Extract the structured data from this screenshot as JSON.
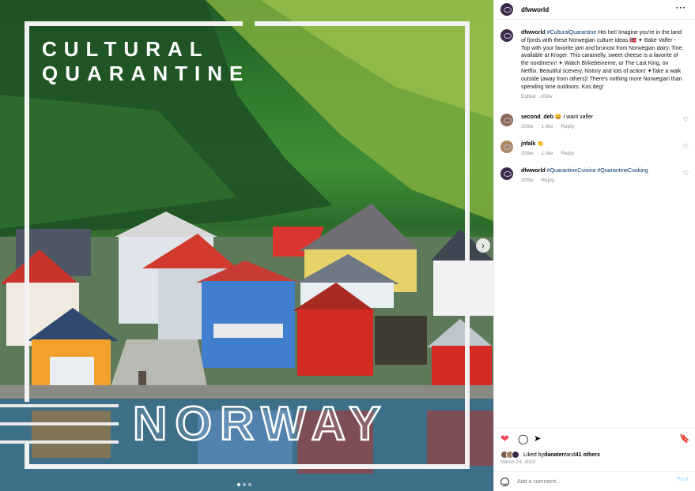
{
  "image": {
    "title_line1": "CULTURAL",
    "title_line2": "QUARANTINE",
    "big_word": "NORWAY",
    "next_glyph": "›"
  },
  "header": {
    "username": "dfwworld",
    "more_glyph": "···"
  },
  "caption": {
    "username": "dfwworld",
    "hashtag": "#CulturalQuarantine",
    "text": " Hei hei! Imagine you're in the land of fjords with these Norwegian culture ideas 🇳🇴 ✦ Bake Vafler - Top with your favorite jam and brunost from Norwegian dairy, Tine, available at Kroger. This caramelly, sweet cheese is a favorite of the nordmenn! ✦ Watch Birkebeinerne, or The Last King, on Netflix. Beautiful scenery, history and lots of action! ✦Take a walk outside (away from others)! There's nothing more Norwegian than spending time outdoors. Kos deg!",
    "edited": "Edited · 209w"
  },
  "comments": [
    {
      "user": "second_deb",
      "text": " 😀 I want vafler",
      "age": "209w",
      "likes": "1 like",
      "reply": "Reply"
    },
    {
      "user": "jnfalk",
      "text": " 👏",
      "age": "209w",
      "likes": "1 like",
      "reply": "Reply"
    },
    {
      "user": "dfwworld",
      "text_tags": "#QuarantineCuisine #QuarantineCooking",
      "age": "209w",
      "reply": "Reply"
    }
  ],
  "actions": {
    "heart_glyph": "❤",
    "comment_glyph": "◯",
    "share_glyph": "➤",
    "save_glyph": "🔖"
  },
  "likes": {
    "prefix": "Liked by ",
    "user": "danaterr",
    "mid": " and ",
    "others": "41 others"
  },
  "date": "March 24, 2020",
  "add_comment": {
    "placeholder": "Add a comment...",
    "post_label": "Post"
  },
  "colors": {
    "heart": "#ed4956",
    "link": "#00376b",
    "meta": "#8e8e8e"
  }
}
